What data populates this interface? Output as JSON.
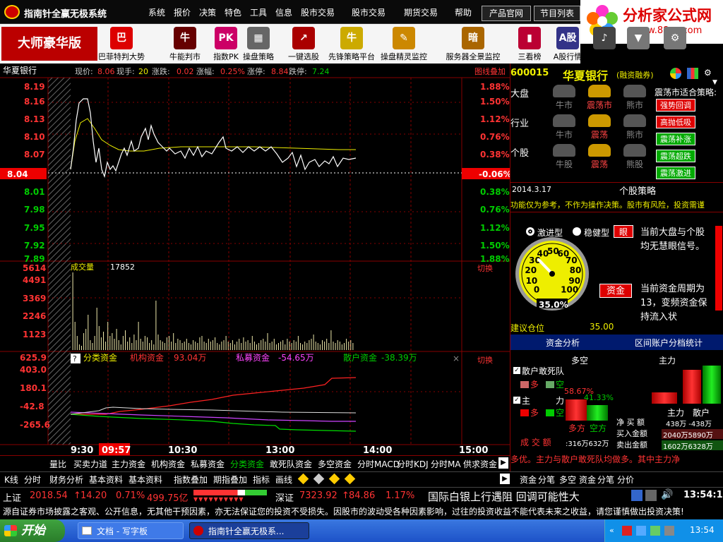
{
  "app": {
    "title": "指南针全赢无极系统",
    "menu": [
      "系统",
      "报价",
      "决策",
      "特色",
      "工具",
      "信息",
      "股市交易",
      "股市交易",
      "期货交易",
      "帮助"
    ],
    "btn_official": "产品官网",
    "btn_programs": "节目列表",
    "close_icon": "×"
  },
  "logo": {
    "name": "分析家公式网",
    "url": "www.88gs.com"
  },
  "edition": "大师豪华版",
  "toolbar": [
    {
      "label": "巴菲特判大势",
      "icon": "巴",
      "color": "#d00"
    },
    {
      "label": "牛能判市",
      "icon": "牛",
      "color": "#600"
    },
    {
      "label": "指数PK",
      "icon": "PK",
      "color": "#c06"
    },
    {
      "label": "操盘策略",
      "icon": "▦",
      "color": "#666"
    },
    {
      "label": "一键选股",
      "icon": "↗",
      "color": "#a00"
    },
    {
      "label": "先锋策略平台",
      "icon": "牛",
      "color": "#ca0"
    },
    {
      "label": "操盘精灵监控",
      "icon": "✎",
      "color": "#c80"
    },
    {
      "label": "服务器全景监控",
      "icon": "暗",
      "color": "#a60"
    },
    {
      "label": "三看榜",
      "icon": "▮",
      "color": "#b03"
    },
    {
      "label": "A股行情",
      "icon": "A股",
      "color": "#338"
    },
    {
      "label": "指南通",
      "icon": "♪",
      "color": "#444"
    },
    {
      "label": "盘后数据下载",
      "icon": "▼",
      "color": "#777"
    },
    {
      "label": "启动界面",
      "icon": "⚙",
      "color": "#777"
    }
  ],
  "quote": {
    "name": "华夏银行",
    "price_label": "现价:",
    "price": "8.06",
    "vol_label": "现手:",
    "vol": "20",
    "chg_label": "涨跌:",
    "chg": "0.02",
    "pct_label": "涨幅:",
    "pct": "0.25%",
    "up_label": "涨停:",
    "up": "8.84",
    "down_label": "跌停:",
    "down": "7.24",
    "overlay": "图线叠加"
  },
  "price_axis": [
    "8.19",
    "8.16",
    "8.13",
    "8.10",
    "8.07",
    "8.04",
    "8.01",
    "7.98",
    "7.95",
    "7.92",
    "7.89"
  ],
  "pct_axis": [
    "1.88%",
    "1.50%",
    "1.12%",
    "0.76%",
    "0.38%",
    "-0.06%",
    "0.38%",
    "0.76%",
    "1.12%",
    "1.50%",
    "1.88%"
  ],
  "volume": {
    "label": "成交量",
    "value": "17852",
    "axis": [
      "5614",
      "4491",
      "3369",
      "2246",
      "1123"
    ],
    "switch": "切换"
  },
  "fund": {
    "help": "?",
    "label": "分类资金",
    "inst_label": "机构资金",
    "inst": "93.04万",
    "priv_label": "私募资金",
    "priv": "-54.65万",
    "retail_label": "散户资金",
    "retail": "-38.39万",
    "axis": [
      "625.9",
      "403.0",
      "180.1",
      "-42.8",
      "-265.6"
    ],
    "switch": "切换",
    "close": "×"
  },
  "time_axis": [
    "9:30",
    "09:57",
    "10:30",
    "13:00",
    "14:00",
    "15:00"
  ],
  "bottom_tabs": [
    "量比",
    "买卖力道",
    "主力资金",
    "机构资金",
    "私募资金",
    "分类资金",
    "敢死队资金",
    "多空资金",
    "分时MACD",
    "分时KDJ",
    "分时MA",
    "供求资金"
  ],
  "tabs2": [
    "K线",
    "分时",
    "财务分析",
    "基本资料",
    "基本资料",
    "指数叠加",
    "期指叠加",
    "指标",
    "画线"
  ],
  "side": {
    "code": "600015",
    "name": "华夏银行",
    "tag": "(融资融券)",
    "rows": [
      {
        "label": "大盘",
        "a": "牛市",
        "b": "震荡市",
        "c": "熊市"
      },
      {
        "label": "行业",
        "a": "牛市",
        "b": "震荡",
        "c": "熊市"
      },
      {
        "label": "个股",
        "a": "牛股",
        "b": "震荡",
        "c": "熊股"
      }
    ],
    "strategy_title": "震荡市适合策略:",
    "strategies": [
      {
        "t": "强势回调",
        "c": "#d00"
      },
      {
        "t": "高抛低吸",
        "c": "#d00"
      },
      {
        "t": "震荡补涨",
        "c": "#0a0"
      },
      {
        "t": "震荡超跌",
        "c": "#0a0"
      },
      {
        "t": "震荡激进",
        "c": "#0a0"
      }
    ],
    "date": "2014.3.17",
    "stock_strategy": "个股策略",
    "note": "功能仅为参考，不作为操作决策。股市有风险，投资需谨",
    "radio1": "激进型",
    "radio2": "稳健型",
    "btn_eye": "眼",
    "msg1": "当前大盘与个股均无慧眼信号。",
    "btn_fund": "资金",
    "msg2": "当前资金周期为13，变频资金保持流入状",
    "gauge": "35.0%",
    "gauge_ticks": [
      "0",
      "10",
      "20",
      "30",
      "40",
      "50",
      "60",
      "70",
      "80",
      "90",
      "100"
    ],
    "position_label": "建议仓位",
    "position": "35.00",
    "tab1": "资金分析",
    "tab2": "区间账户分档统计",
    "bull_bear": "多空",
    "main_force": "主力",
    "chk1": "散户敢死队",
    "chk2": "主",
    "more": "多",
    "empty": "空",
    "main_label": "力",
    "pct_red": "58.67%",
    "pct_green": "41.33%",
    "more_side": "多方",
    "empty_side": "空方",
    "main_retail1": "主力",
    "main_retail2": "散户",
    "net_buy": "净 买 额",
    "net_buy_v": "438万 -438万",
    "buy_amt": "买入金额",
    "buy_amt_v": "2040万5890万",
    "sell_amt": "卖出金额",
    "sell_amt_v": "1602万6328万",
    "turnover": "成 交 额",
    "turnover_v": ":316万632万",
    "scroll_msg": "多优。主力与散户敢死队均做多。其中主力净"
  },
  "tabs3": [
    "资金",
    "分笔",
    "多空",
    "资金",
    "分笔",
    "分价"
  ],
  "ticker": {
    "sh_label": "上证",
    "sh": "2018.54",
    "sh_chg": "14.20",
    "sh_pct": "0.71%",
    "sh_vol": "499.75亿",
    "sz_label": "深证",
    "sz": "7323.92",
    "sz_chg": "84.86",
    "sz_pct": "1.17%",
    "news": "国际白银上行遇阻 回调可能性大",
    "time": "13:54:11"
  },
  "disclaimer": "源自证券市场披露之客观、公开信息，无其他干预因素，亦无法保证您的投资不受损失。因股市的波动受各种因素影响，过往的投资收益不能代表未来之收益，请您谨慎做出投资决策!",
  "taskbar": {
    "start": "开始",
    "task1": "文档 - 写字板",
    "task2": "指南针全赢无极系...",
    "clock": "13:54"
  }
}
